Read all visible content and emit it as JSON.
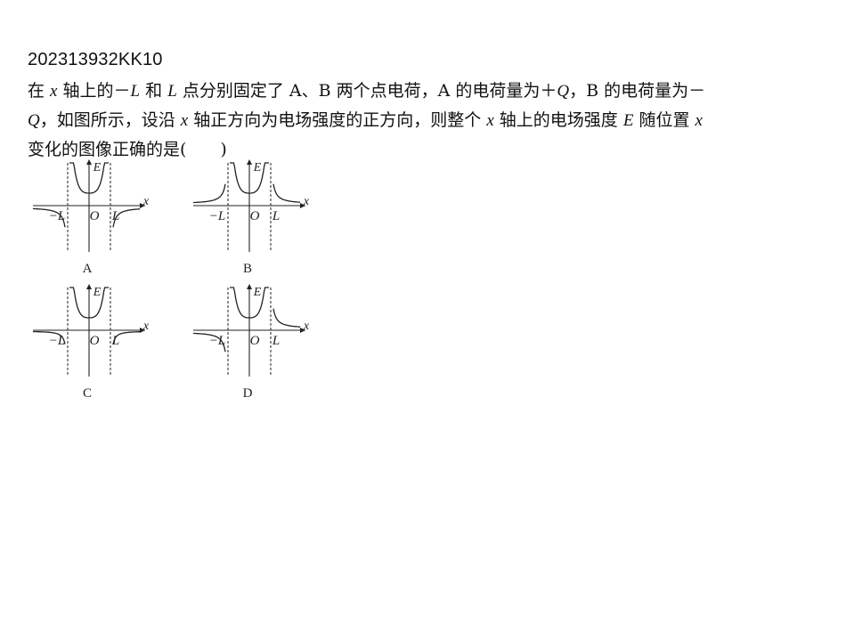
{
  "question": {
    "id": "202313932KK10",
    "lines": [
      [
        {
          "t": "在 "
        },
        {
          "t": "x",
          "i": true
        },
        {
          "t": " 轴上的－"
        },
        {
          "t": "L",
          "i": true
        },
        {
          "t": " 和 "
        },
        {
          "t": "L",
          "i": true
        },
        {
          "t": " 点分别固定了 A、B 两个点电荷，A 的电荷量为＋"
        },
        {
          "t": "Q",
          "i": true
        },
        {
          "t": "，B 的电荷量为－"
        }
      ],
      [
        {
          "t": "Q",
          "i": true
        },
        {
          "t": "，如图所示，设沿 "
        },
        {
          "t": "x",
          "i": true
        },
        {
          "t": " 轴正方向为电场强度的正方向，则整个 "
        },
        {
          "t": "x",
          "i": true
        },
        {
          "t": " 轴上的电场强度 "
        },
        {
          "t": "E",
          "i": true
        },
        {
          "t": " 随位置 "
        },
        {
          "t": "x",
          "i": true
        }
      ],
      [
        {
          "t": "变化的图像正确的是(　　)"
        }
      ]
    ]
  },
  "graphs": {
    "axis_labels": {
      "y": "E",
      "x": "x",
      "origin": "O",
      "neg": "−L",
      "pos": "L"
    },
    "options": [
      {
        "label": "A",
        "shape": "A"
      },
      {
        "label": "B",
        "shape": "B"
      },
      {
        "label": "C",
        "shape": "C"
      },
      {
        "label": "D",
        "shape": "D"
      }
    ]
  }
}
